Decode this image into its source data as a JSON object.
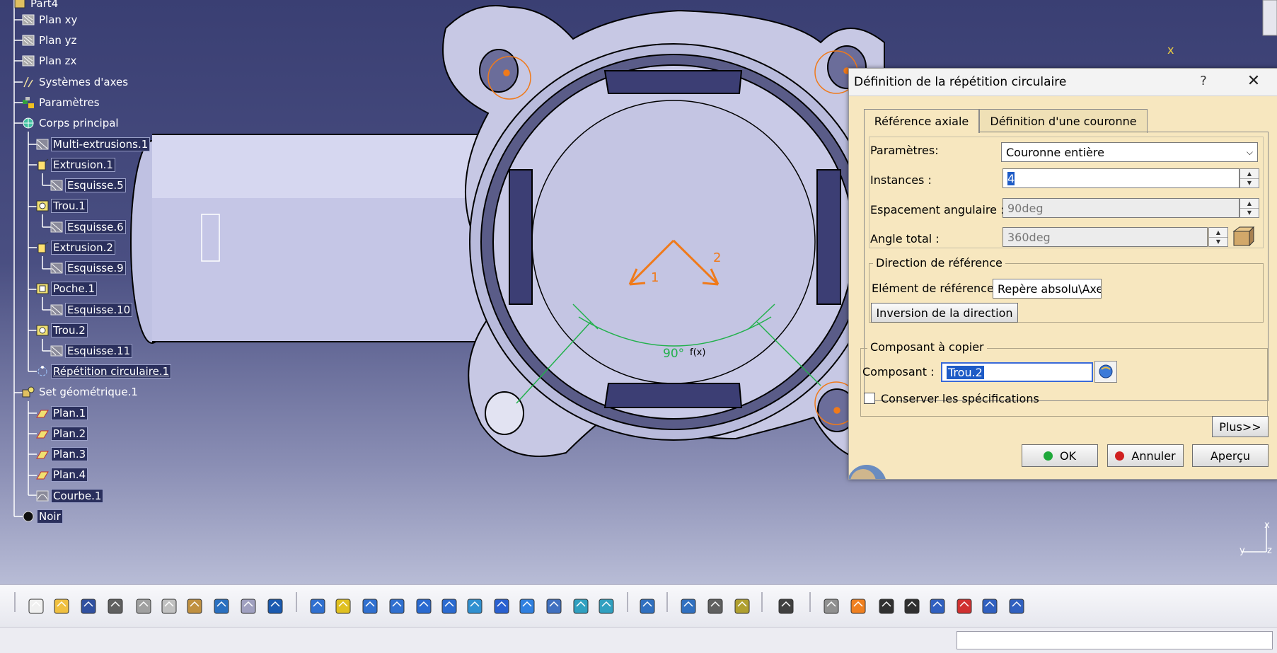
{
  "tree": {
    "root": "Part4",
    "items": [
      {
        "label": "Plan xy"
      },
      {
        "label": "Plan yz"
      },
      {
        "label": "Plan zx"
      },
      {
        "label": "Systèmes d'axes"
      },
      {
        "label": "Paramètres"
      },
      {
        "label": "Corps principal"
      },
      {
        "label": "Multi-extrusions.1"
      },
      {
        "label": "Extrusion.1"
      },
      {
        "label": "Esquisse.5"
      },
      {
        "label": "Trou.1"
      },
      {
        "label": "Esquisse.6"
      },
      {
        "label": "Extrusion.2"
      },
      {
        "label": "Esquisse.9"
      },
      {
        "label": "Poche.1"
      },
      {
        "label": "Esquisse.10"
      },
      {
        "label": "Trou.2"
      },
      {
        "label": "Esquisse.11"
      },
      {
        "label": "Répétition circulaire.1"
      },
      {
        "label": "Set géométrique.1"
      },
      {
        "label": "Plan.1"
      },
      {
        "label": "Plan.2"
      },
      {
        "label": "Plan.3"
      },
      {
        "label": "Plan.4"
      },
      {
        "label": "Courbe.1"
      },
      {
        "label": "Noir"
      }
    ]
  },
  "viewport": {
    "direction_label_1": "1",
    "direction_label_2": "2",
    "angle_label": "90°",
    "compass_x": "x",
    "axis_x": "x",
    "axis_y": "y",
    "axis_z": "z"
  },
  "dialog": {
    "title": "Définition de la répétition circulaire",
    "help": "?",
    "close": "✕",
    "tabs": [
      "Référence axiale",
      "Définition d'une couronne"
    ],
    "params_label": "Paramètres:",
    "params_value": "Couronne entière",
    "instances_label": "Instances :",
    "instances_value": "4",
    "spacing_label": "Espacement angulaire :",
    "spacing_value": "90deg",
    "total_angle_label": "Angle total :",
    "total_angle_value": "360deg",
    "direction_group": "Direction de référence",
    "reference_label": "Elément de référence:",
    "reference_value": "Repère absolu\\Axe",
    "reverse_button": "Inversion de la direction",
    "component_group": "Composant à copier",
    "component_label": "Composant :",
    "component_value": "Trou.2",
    "keep_specs_label": "Conserver les spécifications",
    "keep_specs_checked": false,
    "more_button": "Plus>>",
    "ok_button": "OK",
    "cancel_button": "Annuler",
    "preview_button": "Aperçu"
  },
  "colors": {
    "viewport_top": "#3a3f73",
    "part_fill": "#c7c8e4",
    "dialog_bg": "#f7e7bf",
    "selection": "#1e5bc6",
    "highlight": "#f07a1a",
    "dimension": "#22b14c"
  },
  "toolbar_icons": [
    "new-icon",
    "open-icon",
    "save-icon",
    "print-icon",
    "cut-icon",
    "copy-icon",
    "paste-icon",
    "undo-icon",
    "redo-icon",
    "whats-this-icon",
    "fly-mode-icon",
    "fit-all-icon",
    "pan-icon",
    "rotate-icon",
    "zoom-in-icon",
    "zoom-out-icon",
    "normal-view-icon",
    "multi-view-icon",
    "iso-view-icon",
    "shading-icon",
    "hide-show-icon",
    "swap-visible-icon",
    "measure-icon",
    "measure-between-icon",
    "measure-item-icon",
    "mass-icon",
    "capture-icon",
    "update-icon",
    "touch-icon",
    "axis-icon",
    "dimension-icon",
    "cube-icon",
    "constraint-icon",
    "list-icon",
    "plane-icon"
  ]
}
